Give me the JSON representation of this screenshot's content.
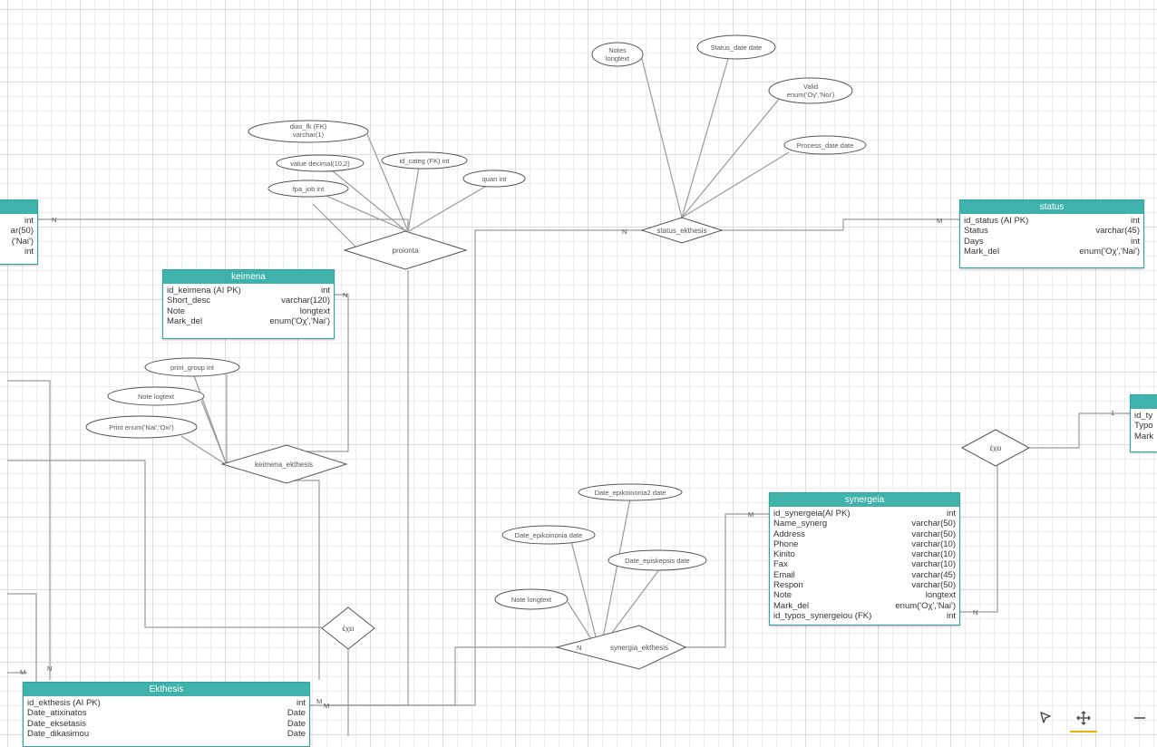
{
  "attributes": {
    "notes": [
      "Notes",
      "longtext"
    ],
    "status_date": "Status_date date",
    "valid": [
      "Valid",
      "enum('Ογ','Νοι')"
    ],
    "process_date": "Process_date date",
    "dias_fk": [
      "dias_fk (FK)",
      "varchar(1)"
    ],
    "value": "value decimal(10,2)",
    "id_categ": "id_categ (FK) int",
    "fpa_job": "fpa_job int",
    "quan": "quan int",
    "print_group": "print_group int",
    "note_logtext": "Note logtext",
    "print_enum": "Print enum('Nai','Oxi')",
    "date_epikoinonia2": "Date_epikoinonia2 date",
    "date_epikoinonia": "Date_epikoinonia date",
    "date_episkepsis": "Date_episkepsis date",
    "note_longtext": "Note longtext"
  },
  "relationships": {
    "proionta": "proionta",
    "status_ekthesis": "status_ekthesis",
    "keimena_ekthesis": "keimena_ekthesis",
    "exei": "έχει",
    "exei2": "έχει",
    "synergia_ekthesis": "synergia_ekthesis"
  },
  "cardinality": {
    "n": "N",
    "m": "M",
    "one": "1"
  },
  "entities": {
    "keimena": {
      "title": "keimena",
      "rows": [
        [
          "id_keimena (AI PK)",
          "int"
        ],
        [
          "Short_desc",
          "varchar(120)"
        ],
        [
          "Note",
          "longtext"
        ],
        [
          "Mark_del",
          "enum('Oχ','Nai')"
        ]
      ]
    },
    "status": {
      "title": "status",
      "rows": [
        [
          "id_status (AI PK)",
          "int"
        ],
        [
          "Status",
          "varchar(45)"
        ],
        [
          "Days",
          "int"
        ],
        [
          "Mark_del",
          "enum('Oχ','Nai')"
        ]
      ]
    },
    "synergeia": {
      "title": "synergeia",
      "rows": [
        [
          "id_synergeia(AI PK)",
          "int"
        ],
        [
          "Name_synerg",
          "varchar(50)"
        ],
        [
          "Address",
          "varchar(50)"
        ],
        [
          "Phone",
          "varchar(10)"
        ],
        [
          "Kinito",
          "varchar(10)"
        ],
        [
          "Fax",
          "varchar(10)"
        ],
        [
          "Email",
          "varchar(45)"
        ],
        [
          "Respon",
          "varchar(50)"
        ],
        [
          "Note",
          "longtext"
        ],
        [
          "Mark_del",
          "enum('Oχ','Nai')"
        ],
        [
          "id_typos_synergeiou (FK)",
          "int"
        ]
      ]
    },
    "ekthesis": {
      "title": "Ekthesis",
      "rows": [
        [
          "id_ekthesis (AI PK)",
          "int"
        ],
        [
          "Date_atixinatos",
          "Date"
        ],
        [
          "Date_eksetasis",
          "Date"
        ],
        [
          "Date_dikasimou",
          "Date"
        ]
      ]
    },
    "left_partial": {
      "rows": [
        "int",
        "ar(50)",
        "('Nai')",
        "int"
      ]
    },
    "right_partial": {
      "rows": [
        "id_ty",
        "Typo",
        "Mark"
      ]
    }
  },
  "toolbar": {
    "pointer_icon": "cursor-arrow-icon",
    "pan_icon": "move-arrows-icon",
    "zoom_out_icon": "minus-icon"
  }
}
